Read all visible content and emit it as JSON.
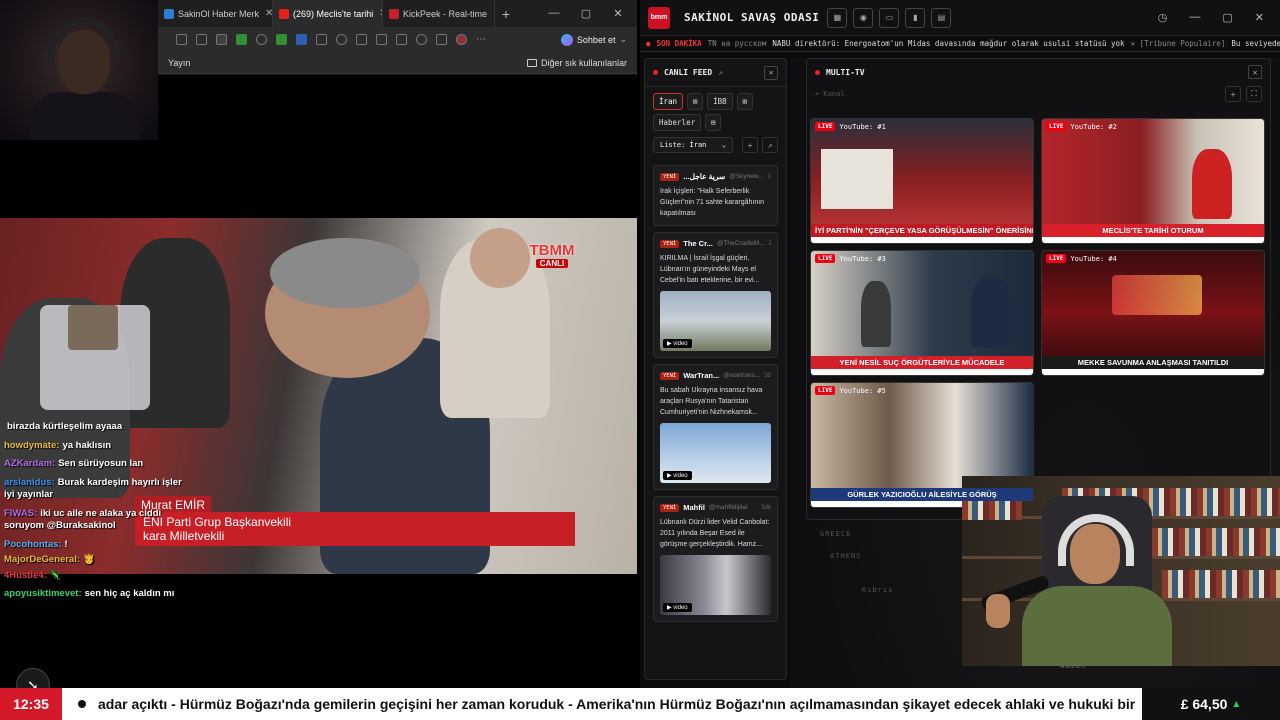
{
  "browser": {
    "tabs": [
      {
        "label": "SakinOl Haber Merk",
        "color": "#2e7bd6",
        "active": false
      },
      {
        "label": "(269) Meclis'te tarihi",
        "color": "#e62117",
        "active": true
      },
      {
        "label": "KickPeek - Real-time",
        "color": "#c6212a",
        "active": false
      }
    ],
    "new_tab": "+",
    "win_min": "—",
    "win_max": "▢",
    "win_close": "✕",
    "chat_label": "Sohbet et",
    "bookmarks": {
      "first": "Yayın",
      "other": "Diğer sık kullanılanlar"
    }
  },
  "video": {
    "channel_logo": "TBMM",
    "channel_live": "CANLI",
    "name": "Murat EMİR",
    "title_line1": "ENİ Parti Grup Başkanvekili",
    "title_line2": "kara Milletvekili"
  },
  "chat": [
    {
      "user": "",
      "text": "birazda kürtleşelim ayaaa",
      "color": "#fff"
    },
    {
      "user": "howdymate:",
      "text": "ya haklısın",
      "color": "#e6b93b"
    },
    {
      "user": "AZKardam:",
      "text": "Sen sürüyosun lan",
      "color": "#b06be8"
    },
    {
      "user": "arslanidus:",
      "text": "Burak kardeşim hayırlı işler iyi yayınlar",
      "color": "#3b8ef0"
    },
    {
      "user": "FIWAS:",
      "text": "iki uc aile ne alaka ya ciddi soruyom @Buraksakinol",
      "color": "#b06be8"
    },
    {
      "user": "Pocohontas:",
      "text": "!",
      "color": "#4db2f0"
    },
    {
      "user": "MajorDeGeneral:",
      "text": "🫅",
      "color": "#e6b93b"
    },
    {
      "user": "4Hustle4:",
      "text": "🦎",
      "color": "#e03c3c"
    },
    {
      "user": "apoyusiktimevet:",
      "text": "sen hiç aç kaldın mı",
      "color": "#3bd06b"
    }
  ],
  "dashboard": {
    "logo": "bmm",
    "title": "SAKİNOL SAVAŞ ODASI",
    "ticker": {
      "label": "SON DAKİKA",
      "text1": "ТN на русском",
      "text2": "NABU direktörü: Energoatom'un Midas davasında mağdur olarak usulsi statüsü yok",
      "text3": "✕ [Tribune Populaire]",
      "text4": "Bu seviyedeki ırkçılığa d"
    },
    "feed": {
      "title": "CANLI FEED",
      "tabs": [
        "İran",
        "⊞",
        "İBB",
        "⊞",
        "Haberler",
        "⊞"
      ],
      "list_label": "Liste:",
      "list_value": "İran",
      "cards": [
        {
          "source": "...سرية عاجل",
          "handle": "@Skynew...",
          "time": "1dk",
          "text": "Irak İçişleri: \"Halk Seferberlik Güçleri\"nin 71 sahte karargâhının kapatılması",
          "video": ""
        },
        {
          "source": "The Cr...",
          "handle": "@TheCradleM...",
          "time": "2dk",
          "text": "KIRILMA | İsrail İşgal güçleri, Lübnan'ın güneyindeki Mays el Cebel'in batı eteklerine, bir evi...",
          "video": "▶ video"
        },
        {
          "source": "WarTran...",
          "handle": "@wartrans...",
          "time": "3dk",
          "text": "Bu sabah Ukrayna insansız hava araçları Rusya'nın Tataristan Cumhuriyeti'nin Nizhnekamsk...",
          "video": "▶ video"
        },
        {
          "source": "Mahfil",
          "handle": "@mahfildijital",
          "time": "5dk",
          "text": "Lübnanlı Dürzi lider Velid Canbolat: 2011 yılında Beşar Esed ile görüşme gerçekleştirdik. Hamz...",
          "video": "▶ video"
        }
      ]
    },
    "multitv": {
      "title": "MULTI-TV",
      "sub": "+ Kanal",
      "tvs": [
        {
          "label": "YouTube: #1",
          "caption": "İYİ PARTİ'NİN \"ÇERÇEVE YASA GÖRÜŞÜLMESİN\" ÖNERİSİNE RET",
          "bg": "#8a1f22",
          "capcolor": "#c01b22"
        },
        {
          "label": "YouTube: #2",
          "caption": "MECLİS'TE TARİHİ OTURUM",
          "bg": "#b5252a",
          "capcolor": "#d8202a"
        },
        {
          "label": "YouTube: #3",
          "caption": "YENİ NESİL SUÇ ÖRGÜTLERİYLE MÜCADELE",
          "bg": "#1f3346",
          "capcolor": "#d31f2a"
        },
        {
          "label": "YouTube: #4",
          "caption": "MEKKE SAVUNMA ANLAŞMASI TANITILDI",
          "bg": "#3a0b0e",
          "capcolor": "#1a1a1a"
        },
        {
          "label": "YouTube: #5",
          "caption": "GÜRLEK YAZICIOĞLU AİLESİYLE GÖRÜŞ",
          "bg": "#6e5a4a",
          "capcolor": "#1f3a7a"
        }
      ]
    },
    "map_labels": [
      "GREECE",
      "ATHENS",
      "Kıbrıs",
      "Amman"
    ]
  },
  "bottom": {
    "clock": "12:35",
    "ticker": "adar açıktı - Hürmüz Boğazı'nda gemilerin geçişini her zaman koruduk - Amerika'nın Hürmüz Boğazı'nın açılmamasından şikayet edecek ahlaki ve hukuki bir",
    "price": "£ 64,50",
    "price_dir": "▲"
  }
}
